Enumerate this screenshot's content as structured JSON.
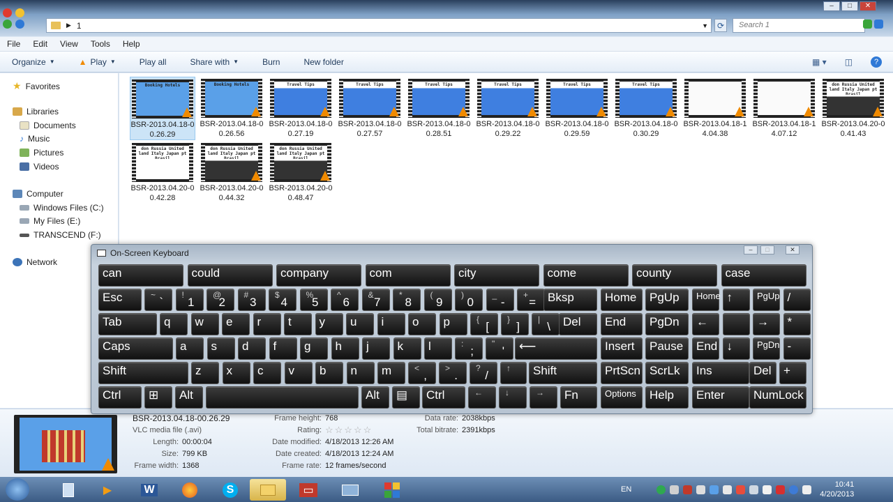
{
  "window": {
    "address_crumb": "1",
    "search_placeholder": "Search 1"
  },
  "menu": [
    "File",
    "Edit",
    "View",
    "Tools",
    "Help"
  ],
  "toolbar": {
    "organize": "Organize",
    "play": "Play",
    "play_all": "Play all",
    "share_with": "Share with",
    "burn": "Burn",
    "new_folder": "New folder"
  },
  "nav": {
    "favorites": "Favorites",
    "libraries": "Libraries",
    "documents": "Documents",
    "music": "Music",
    "pictures": "Pictures",
    "videos": "Videos",
    "computer": "Computer",
    "drive_c": "Windows Files (C:)",
    "drive_e": "My Files (E:)",
    "drive_f": "TRANSCEND (F:)",
    "network": "Network"
  },
  "files": [
    {
      "name": "BSR-2013.04.18-0\n0.26.29",
      "kind": "hotel"
    },
    {
      "name": "BSR-2013.04.18-0\n0.26.56",
      "kind": "hotel"
    },
    {
      "name": "BSR-2013.04.18-0\n0.27.19",
      "kind": "travel"
    },
    {
      "name": "BSR-2013.04.18-0\n0.27.57",
      "kind": "travel"
    },
    {
      "name": "BSR-2013.04.18-0\n0.28.51",
      "kind": "travel"
    },
    {
      "name": "BSR-2013.04.18-0\n0.29.22",
      "kind": "travel"
    },
    {
      "name": "BSR-2013.04.18-0\n0.29.59",
      "kind": "travel"
    },
    {
      "name": "BSR-2013.04.18-0\n0.30.29",
      "kind": "travel"
    },
    {
      "name": "BSR-2013.04.18-1\n4.04.38",
      "kind": "blank"
    },
    {
      "name": "BSR-2013.04.18-1\n4.07.12",
      "kind": "blank"
    },
    {
      "name": "BSR-2013.04.20-0\n0.41.43",
      "kind": "kbd"
    },
    {
      "name": "BSR-2013.04.20-0\n0.42.28",
      "kind": "text"
    },
    {
      "name": "BSR-2013.04.20-0\n0.44.32",
      "kind": "kbd"
    },
    {
      "name": "BSR-2013.04.20-0\n0.48.47",
      "kind": "kbd"
    }
  ],
  "thumb_text": {
    "hotel": "Booking Hotels",
    "travel": "Travel Tips",
    "russia": "don Russia United land Italy Japan pt Brasil"
  },
  "details": {
    "filename": "BSR-2013.04.18-00.26.29",
    "type": "VLC media file (.avi)",
    "length_label": "Length:",
    "length": "00:00:04",
    "size_label": "Size:",
    "size": "799 KB",
    "fwidth_label": "Frame width:",
    "fwidth": "1368",
    "fheight_label": "Frame height:",
    "fheight": "768",
    "rating_label": "Rating:",
    "rating": "☆☆☆☆☆",
    "modified_label": "Date modified:",
    "modified": "4/18/2013 12:26 AM",
    "created_label": "Date created:",
    "created": "4/18/2013 12:24 AM",
    "frate_label": "Frame rate:",
    "frate": "12 frames/second",
    "drate_label": "Data rate:",
    "drate": "2038kbps",
    "brate_label": "Total bitrate:",
    "brate": "2391kbps"
  },
  "osk": {
    "title": "On-Screen Keyboard",
    "predictions": [
      "can",
      "could",
      "company",
      "com",
      "city",
      "come",
      "county",
      "case"
    ]
  },
  "tray": {
    "lang": "EN",
    "time": "10:41",
    "date": "4/20/2013"
  },
  "colors": {
    "accent": "#3b5b84",
    "select": "#cce4f7"
  }
}
